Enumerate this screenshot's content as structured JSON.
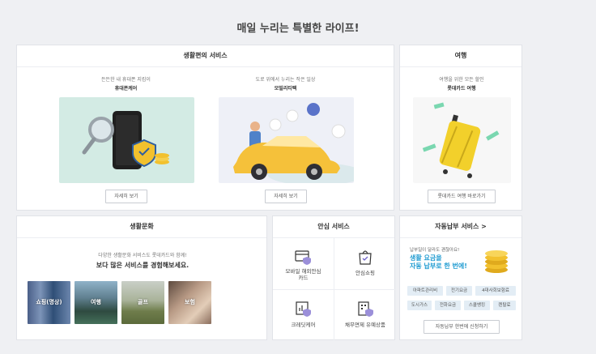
{
  "page_title": "매일 누리는 특별한 라이프!",
  "life_service": {
    "header": "생활편의 서비스",
    "items": [
      {
        "subtitle": "든든한 내 휴대폰 지킴이",
        "name": "휴대폰케어",
        "button": "자세히 보기"
      },
      {
        "subtitle": "도로 위에서 누리는 작은 일상",
        "name": "모빌리티팩",
        "button": "자세히 보기"
      }
    ]
  },
  "travel": {
    "header": "여행",
    "subtitle": "여행을 위한 모든 할인",
    "name": "롯데카드 여행",
    "button": "롯데카드 여행 바로가기"
  },
  "culture": {
    "header": "생활문화",
    "line1": "다양한 생활문화 서비스도 롯데카드와 함께!",
    "line2": "보다 많은 서비스를 경험해보세요.",
    "thumbs": [
      {
        "label": "쇼핑(명상)"
      },
      {
        "label": "여행"
      },
      {
        "label": "골프"
      },
      {
        "label": "보험"
      }
    ]
  },
  "safety": {
    "header": "안심 서비스",
    "items": [
      {
        "label": "모바일 해외안심카드",
        "icon": "card-shield-icon"
      },
      {
        "label": "안심쇼핑",
        "icon": "shopping-bag-check-icon"
      },
      {
        "label": "크레딧케어",
        "icon": "chart-shield-icon"
      },
      {
        "label": "채무면제 유예상품",
        "icon": "building-shield-icon"
      }
    ]
  },
  "autopay": {
    "header": "자동납부 서비스 >",
    "small": "납부일이 달라도 괜찮아요!",
    "big1": "생활 요금을",
    "big2": "자동 납부로 한 번에!",
    "tags": [
      "아파트관리비",
      "전기요금",
      "4대사회보험료",
      "도시가스",
      "전화요금",
      "스쿨뱅킹",
      "렌탈료"
    ],
    "button": "자동납부 한번에 신청하기"
  },
  "colors": {
    "accent": "#1f9bd1",
    "coin": "#f2c12e",
    "car": "#f5c13a"
  }
}
